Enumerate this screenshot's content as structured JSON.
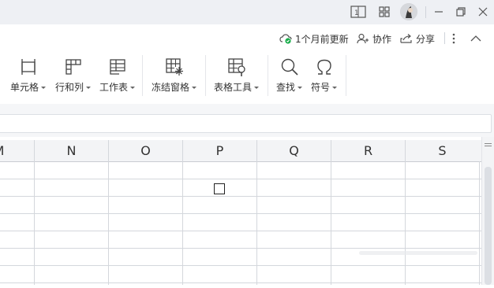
{
  "inforow": {
    "cloud_status": "1个月前更新",
    "collaborate": "协作",
    "share": "分享"
  },
  "ribbon": {
    "groups": [
      {
        "label": "单元格",
        "icon": "cell-icon"
      },
      {
        "label": "行和列",
        "icon": "rows-columns-icon"
      },
      {
        "label": "工作表",
        "icon": "worksheet-icon"
      },
      {
        "label": "冻结窗格",
        "icon": "freeze-panes-icon"
      },
      {
        "label": "表格工具",
        "icon": "table-tools-icon"
      },
      {
        "label": "查找",
        "icon": "search-icon"
      },
      {
        "label": "符号",
        "icon": "symbol-omega-icon"
      }
    ]
  },
  "sheet": {
    "columns": [
      "M",
      "N",
      "O",
      "P",
      "Q",
      "R",
      "S"
    ],
    "selected_cell_marker": "checkbox-icon"
  },
  "colors": {
    "titlebar": "#eef0f4",
    "sync_ok": "#1aad4b",
    "gridline": "#d4d7dc"
  }
}
